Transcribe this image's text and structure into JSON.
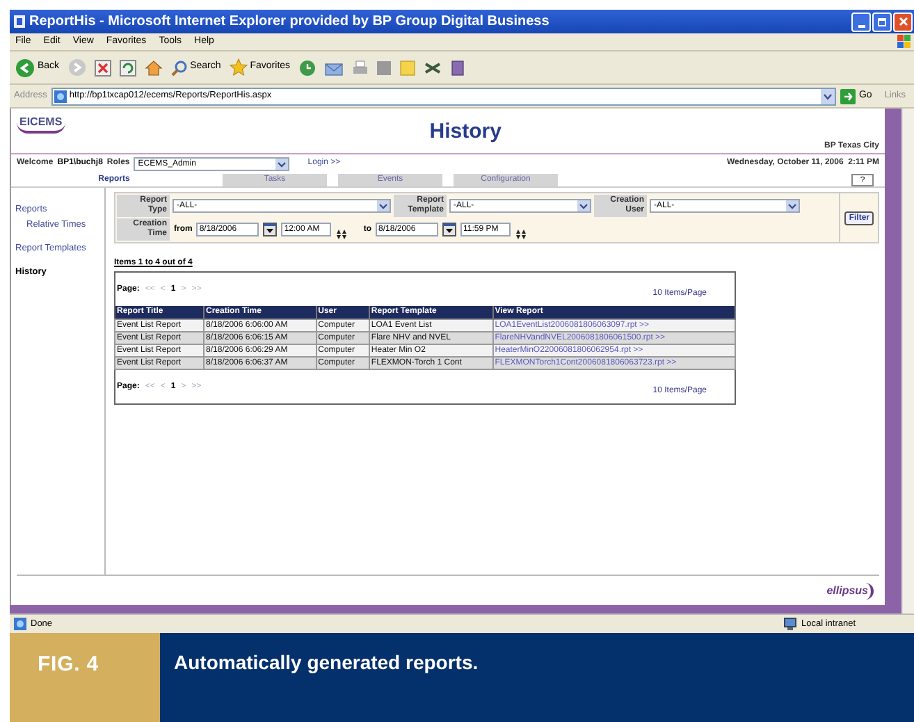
{
  "window": {
    "title": "ReportHis - Microsoft Internet Explorer provided by BP Group Digital Business"
  },
  "menu": [
    "File",
    "Edit",
    "View",
    "Favorites",
    "Tools",
    "Help"
  ],
  "toolbar": {
    "back": "Back",
    "search": "Search",
    "favorites": "Favorites"
  },
  "address": {
    "label": "Address",
    "url": "http://bp1txcap012/ecems/Reports/ReportHis.aspx",
    "go": "Go",
    "links": "Links"
  },
  "page": {
    "logo": "EICEMS",
    "title": "History",
    "site": "BP Texas City",
    "welcome": "Welcome",
    "user": "BP1\\buchj8",
    "roles_label": "Roles",
    "role": "ECEMS_Admin",
    "login": "Login >>",
    "date": "Wednesday, October 11, 2006  2:11 PM",
    "tabs": [
      {
        "label": "Reports",
        "selected": true
      },
      {
        "label": "Tasks",
        "selected": false
      },
      {
        "label": "Events",
        "selected": false
      },
      {
        "label": "Configuration",
        "selected": false
      }
    ],
    "help": "?",
    "sidebar": [
      {
        "label": "Reports",
        "selected": false,
        "children": [
          {
            "label": "Relative Times",
            "selected": false
          }
        ]
      },
      {
        "label": "Report Templates",
        "selected": false
      },
      {
        "label": "History",
        "selected": true
      }
    ],
    "filters": {
      "report_type": {
        "label": "Report Type",
        "value": "-ALL-"
      },
      "report_template": {
        "label": "Report Template",
        "value": "-ALL-"
      },
      "creation_user": {
        "label": "Creation User",
        "value": "-ALL-"
      },
      "creation_time": {
        "label": "Creation Time",
        "from_label": "from",
        "from_date": "8/18/2006",
        "from_time": "12:00 AM",
        "to_label": "to",
        "to_date": "8/18/2006",
        "to_time": "11:59 PM"
      },
      "filter_button": "Filter"
    },
    "items_info": "Items 1 to 4 out of 4",
    "table": {
      "pager_top": {
        "label": "Page:",
        "first": "<<",
        "prev": "<",
        "page": "1",
        "next": ">",
        "last": ">>",
        "per_page": "10 Items/Page"
      },
      "columns": [
        "Report Title",
        "Creation Time",
        "User",
        "Report Template",
        "View Report"
      ],
      "rows": [
        [
          "Event List Report",
          "8/18/2006 6:06:00 AM",
          "Computer",
          "LOA1 Event List",
          "LOA1EventList2006081806063097.rpt >>"
        ],
        [
          "Event List Report",
          "8/18/2006 6:06:15 AM",
          "Computer",
          "Flare NHV and NVEL",
          "FlareNHVandNVEL2006081806061500.rpt >>"
        ],
        [
          "Event List Report",
          "8/18/2006 6:06:29 AM",
          "Computer",
          "Heater Min O2",
          "HeaterMinO22006081806062954.rpt >>"
        ],
        [
          "Event List Report",
          "8/18/2006 6:06:37 AM",
          "Computer",
          "FLEXMON-Torch 1 Cont",
          "FLEXMONTorch1Cont2006081806063723.rpt >>"
        ]
      ],
      "pager_bottom": {
        "label": "Page:",
        "first": "<<",
        "prev": "<",
        "page": "1",
        "next": ">",
        "last": ">>",
        "per_page": "10 Items/Page"
      }
    },
    "footer_logo": "ellipsus"
  },
  "status_bar": {
    "text": "Done",
    "zone": "Local intranet"
  },
  "caption": {
    "label": "FIG. 4",
    "text": "Automatically generated reports."
  }
}
